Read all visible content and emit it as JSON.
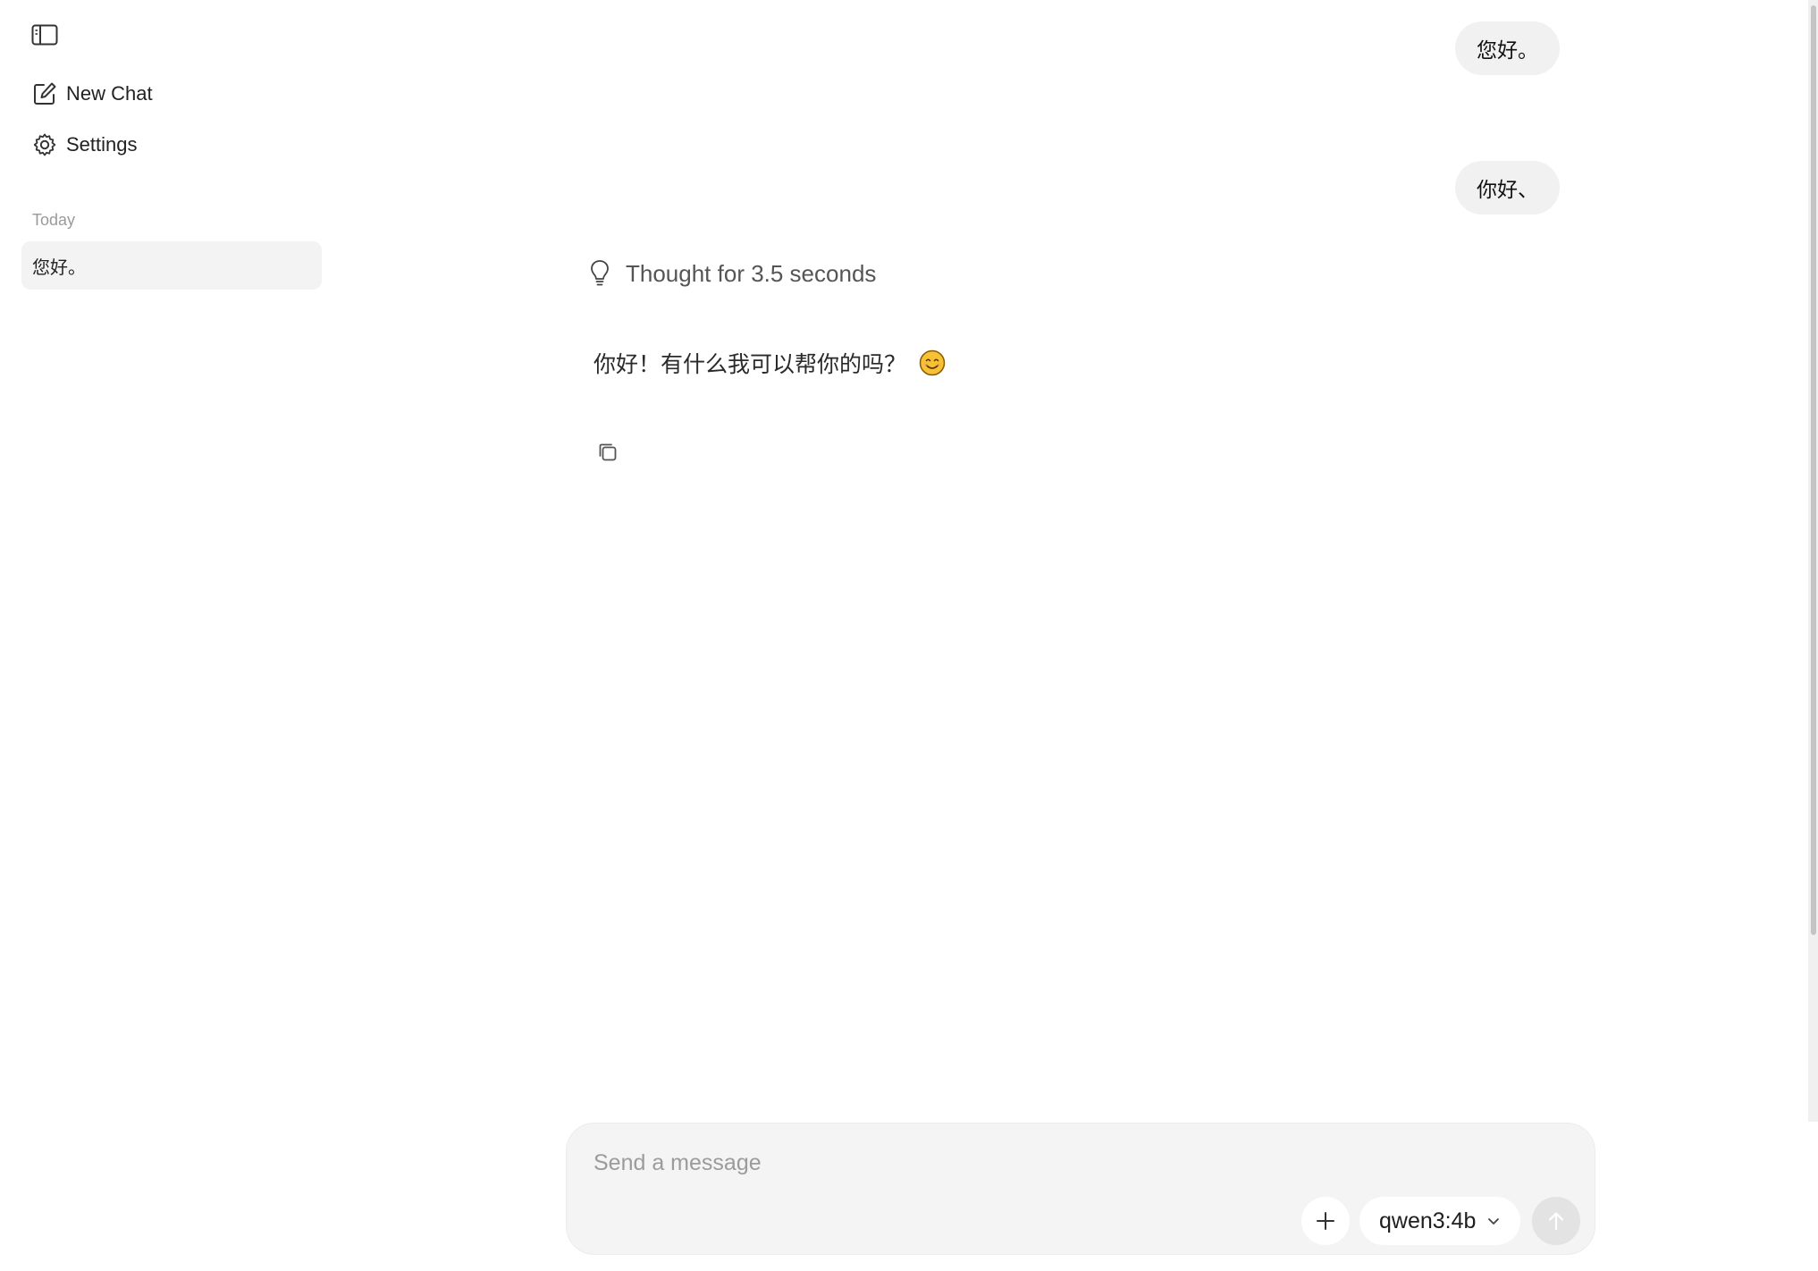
{
  "sidebar": {
    "nav": {
      "new_chat_label": "New Chat",
      "settings_label": "Settings"
    },
    "history_section_label": "Today",
    "history_items": [
      {
        "label": "您好。"
      }
    ]
  },
  "conversation": {
    "user_messages": [
      {
        "text": "您好。"
      },
      {
        "text": "你好、"
      }
    ],
    "thought_label": "Thought for 3.5 seconds",
    "assistant_message": "你好！有什么我可以帮你的吗？"
  },
  "composer": {
    "placeholder": "Send a message",
    "model_label": "qwen3:4b"
  },
  "icons": {
    "sidebar_toggle": "sidebar-toggle-icon",
    "new_chat": "edit-icon",
    "settings": "gear-icon",
    "thought": "lightbulb-icon",
    "emoji": "smiling-face-icon",
    "copy": "copy-icon",
    "attach": "plus-icon",
    "model_dropdown": "chevron-down-icon",
    "send": "arrow-up-icon"
  },
  "colors": {
    "bubble_bg": "#f1f1f1",
    "composer_bg": "#f4f4f4",
    "history_active_bg": "#f3f3f3",
    "send_disabled_bg": "#e3e3e3"
  }
}
